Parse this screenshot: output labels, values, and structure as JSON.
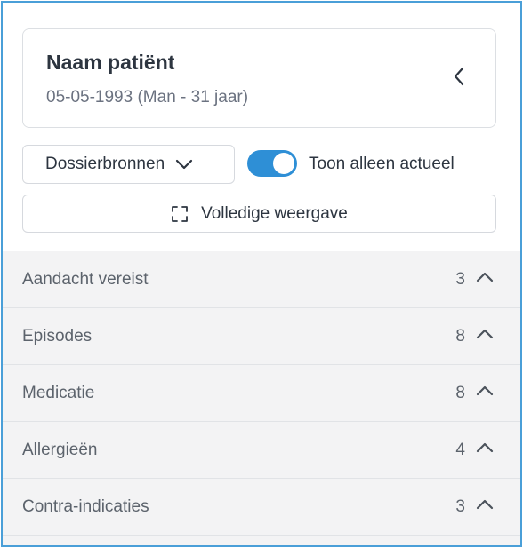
{
  "patient": {
    "name": "Naam patiënt",
    "details": "05-05-1993 (Man - 31 jaar)"
  },
  "controls": {
    "sources_label": "Dossierbronnen",
    "toggle_label": "Toon alleen actueel",
    "toggle_on": true,
    "full_view_label": "Volledige weergave"
  },
  "sections": [
    {
      "label": "Aandacht vereist",
      "count": "3"
    },
    {
      "label": "Episodes",
      "count": "8"
    },
    {
      "label": "Medicatie",
      "count": "8"
    },
    {
      "label": "Allergieën",
      "count": "4"
    },
    {
      "label": "Contra-indicaties",
      "count": "3"
    }
  ],
  "icons": {
    "collapse": "chevron-left-icon",
    "sources_dropdown": "chevron-down-icon",
    "full_view": "expand-icon",
    "section": "chevron-up-icon"
  },
  "colors": {
    "frame_border": "#4a9fd8",
    "toggle_active": "#2e8fd6",
    "section_background": "#f3f3f4"
  }
}
